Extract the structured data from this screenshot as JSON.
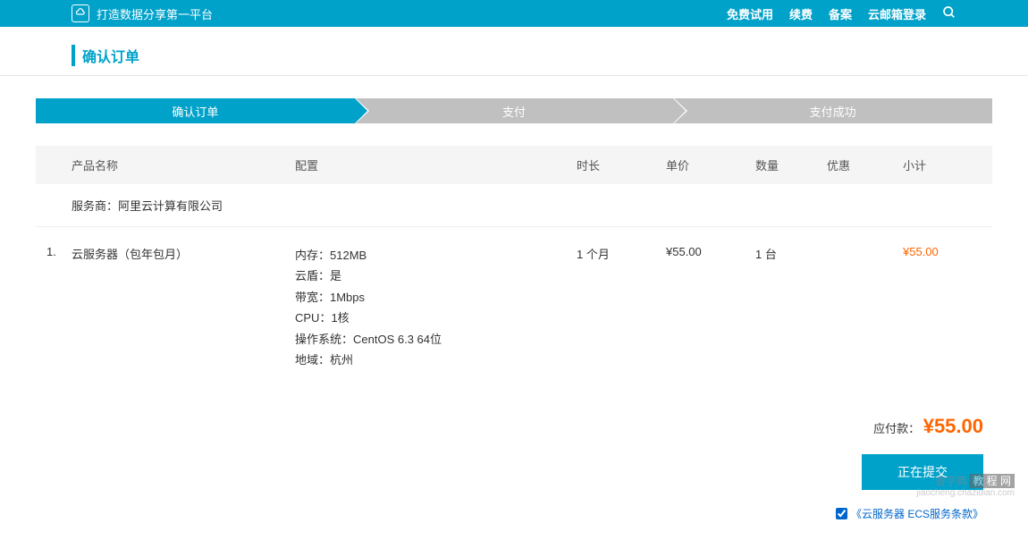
{
  "topbar": {
    "slogan": "打造数据分享第一平台",
    "links": [
      "免费试用",
      "续费",
      "备案",
      "云邮箱登录"
    ]
  },
  "page_title": "确认订单",
  "steps": [
    {
      "label": "确认订单",
      "active": true
    },
    {
      "label": "支付",
      "active": false
    },
    {
      "label": "支付成功",
      "active": false
    }
  ],
  "table": {
    "headers": {
      "name": "产品名称",
      "config": "配置",
      "duration": "时长",
      "price": "单价",
      "qty": "数量",
      "discount": "优惠",
      "subtotal": "小计"
    },
    "provider": "服务商：阿里云计算有限公司",
    "items": [
      {
        "index": "1.",
        "name": "云服务器（包年包月）",
        "config": [
          "内存：512MB",
          "云盾：是",
          "带宽：1Mbps",
          "CPU：1核",
          "操作系统：CentOS 6.3 64位",
          "地域：杭州"
        ],
        "duration": "1 个月",
        "price": "¥55.00",
        "qty": "1 台",
        "discount": "",
        "subtotal": "¥55.00"
      }
    ]
  },
  "footer": {
    "total_label": "应付款：",
    "total_amount": "¥55.00",
    "submit_label": "正在提交",
    "tos_text": "《云服务器 ECS服务条款》"
  },
  "watermark": {
    "cn1": "查字典",
    "cn2": "教 程 网",
    "url": "jiaocheng.chazidian.com"
  }
}
